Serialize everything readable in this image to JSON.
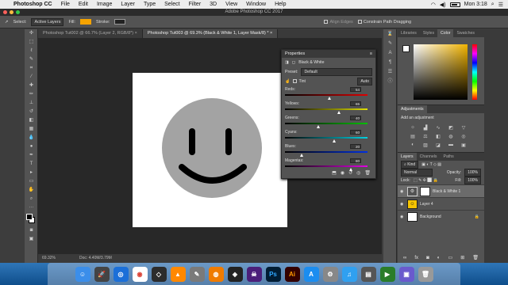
{
  "menubar": {
    "app_name": "Photoshop CC",
    "items": [
      "File",
      "Edit",
      "Image",
      "Layer",
      "Type",
      "Select",
      "Filter",
      "3D",
      "View",
      "Window",
      "Help"
    ],
    "clock": "Mon 3:18"
  },
  "window": {
    "title": "Adobe Photoshop CC 2017"
  },
  "options_bar": {
    "select_label": "Select:",
    "select_value": "Active Layers",
    "fill_label": "Fill:",
    "stroke_label": "Stroke:",
    "align_edges": "Align Edges",
    "constrain": "Constrain Path Dragging",
    "fill_color": "#f5a300"
  },
  "doc_tabs": [
    {
      "label": "Photoshop Tut002 @ 66.7% (Layer 2, RGB/8*)"
    },
    {
      "label": "Photoshop Tut003 @ 69.3% (Black & White 1, Layer Mask/8) *"
    }
  ],
  "status": {
    "zoom": "69.32%",
    "doc": "Doc: 4.40M/3.79M"
  },
  "properties": {
    "title": "Properties",
    "subtitle": "Black & White",
    "preset_label": "Preset:",
    "preset_value": "Default",
    "tint_label": "Tint",
    "auto_label": "Auto",
    "sliders": [
      {
        "label": "Reds:",
        "value": 54,
        "grad": "linear-gradient(to right,#000,#e00000)"
      },
      {
        "label": "Yellows:",
        "value": 65,
        "grad": "linear-gradient(to right,#000,#e0e000)"
      },
      {
        "label": "Greens:",
        "value": 40,
        "grad": "linear-gradient(to right,#000,#00c000)"
      },
      {
        "label": "Cyans:",
        "value": 60,
        "grad": "linear-gradient(to right,#000,#00d0e0)"
      },
      {
        "label": "Blues:",
        "value": 20,
        "grad": "linear-gradient(to right,#000,#0030e0)"
      },
      {
        "label": "Magentas:",
        "value": 80,
        "grad": "linear-gradient(to right,#000,#e000e0)"
      }
    ]
  },
  "right_panels": {
    "color_tabs": [
      "Libraries",
      "Styles",
      "Color",
      "Swatches"
    ],
    "adjustments_title": "Adjustments",
    "adjustments_hint": "Add an adjustment",
    "layer_tabs": [
      "Layers",
      "Channels",
      "Paths"
    ],
    "kind_label": "Kind",
    "blend_mode": "Normal",
    "opacity_label": "Opacity:",
    "opacity_value": "100%",
    "lock_label": "Lock:",
    "fill_label": "Fill:",
    "fill_value": "100%",
    "layers": [
      {
        "name": "Black & White 1",
        "thumb": "⚙"
      },
      {
        "name": "Layer 4",
        "thumb": "☺"
      },
      {
        "name": "Background",
        "thumb": ""
      }
    ]
  }
}
